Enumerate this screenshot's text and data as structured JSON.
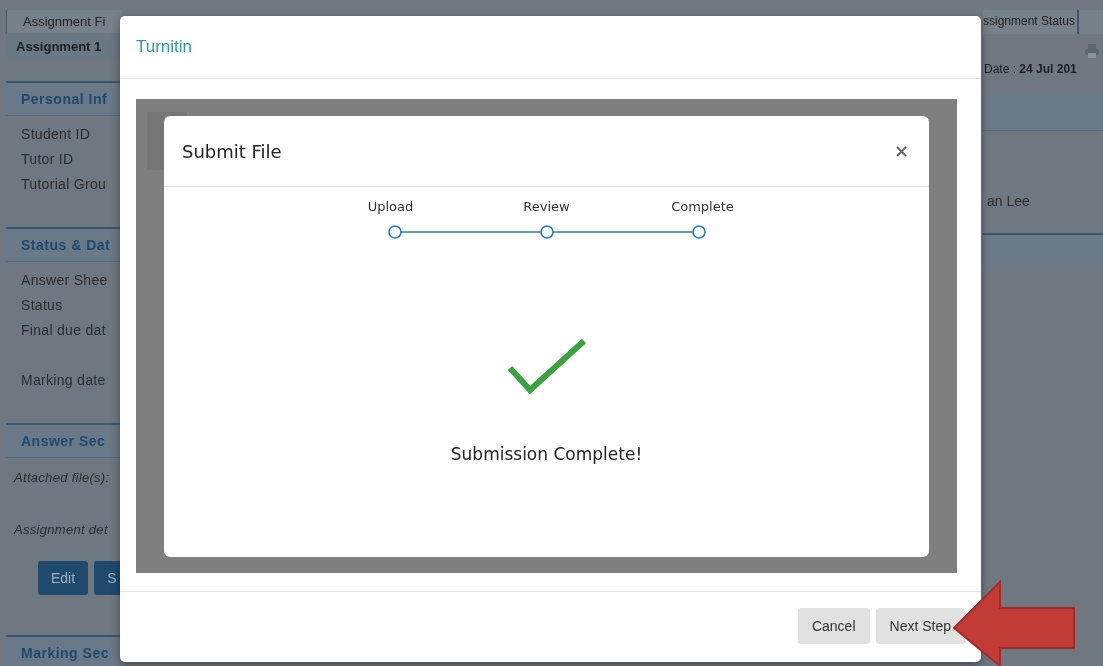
{
  "background_page": {
    "left": {
      "tab": "Assignment Fi",
      "title": "Assignment 1",
      "sections": [
        {
          "heading": "Personal Inf",
          "rows": [
            "Student ID",
            "Tutor ID",
            "Tutorial Grou"
          ]
        },
        {
          "heading": "Status & Dat",
          "rows": [
            "Answer Shee",
            "Status",
            "Final due dat",
            "",
            "Marking date"
          ]
        },
        {
          "heading": "Answer Sec",
          "rows": [
            "Attached file(s):",
            "",
            "Assignment det"
          ],
          "italic": true,
          "buttons": [
            "Edit",
            "S"
          ]
        },
        {
          "heading": "Marking Sec"
        }
      ]
    },
    "right": {
      "tab": "ssignment Status",
      "date": "Date : **24 Jul 201**",
      "value": "an Lee"
    }
  },
  "modal": {
    "title": "Turnitin",
    "dialog": {
      "title": "Submit File",
      "steps": [
        {
          "label": "Upload"
        },
        {
          "label": "Review"
        },
        {
          "label": "Complete"
        }
      ],
      "message": "Submission Complete!"
    },
    "buttons": [
      {
        "label": "Cancel"
      },
      {
        "label": "Next Step"
      }
    ]
  }
}
